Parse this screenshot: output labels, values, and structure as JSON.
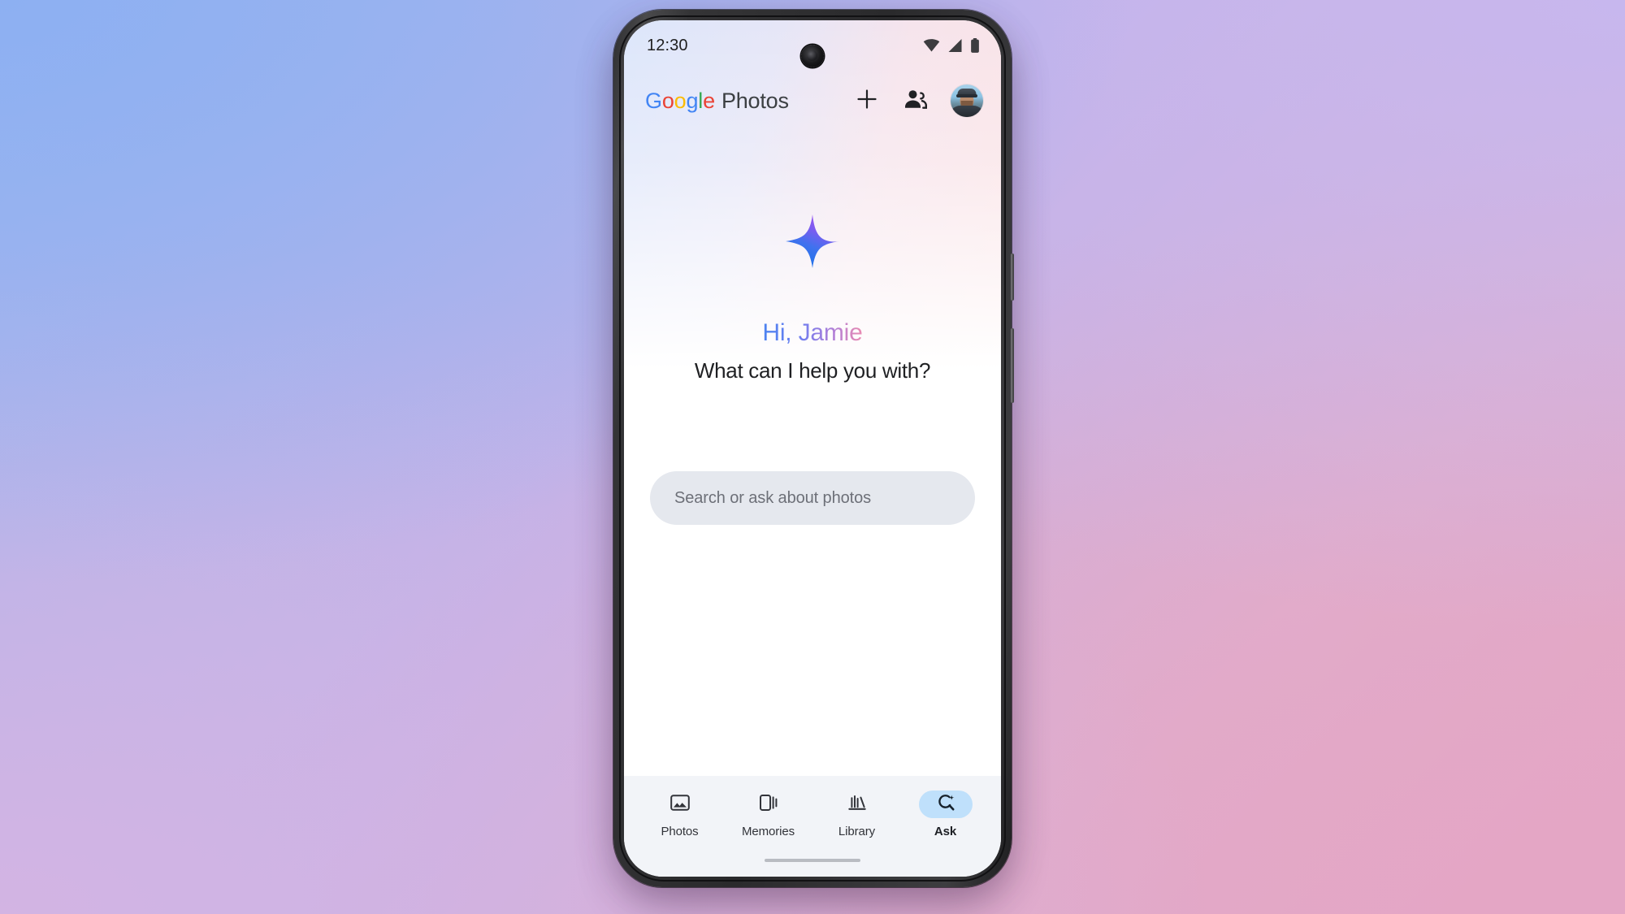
{
  "wallpaper": {
    "color_top_left": "#8db0f2",
    "color_top_right": "#c7b7ee",
    "color_bottom_left": "#d3b4e3",
    "color_bottom_right": "#e4a6c5"
  },
  "device": {
    "frame_color": "#2c2c2e",
    "screen_background": "#ffffff"
  },
  "status_bar": {
    "time": "12:30",
    "icons": [
      "wifi-icon",
      "cellular-signal-icon",
      "battery-icon"
    ]
  },
  "app_bar": {
    "brand_google": "Google",
    "brand_google_letters": [
      {
        "ch": "G",
        "color": "#4285F4"
      },
      {
        "ch": "o",
        "color": "#EA4335"
      },
      {
        "ch": "o",
        "color": "#FBBC05"
      },
      {
        "ch": "g",
        "color": "#4285F4"
      },
      {
        "ch": "l",
        "color": "#34A853"
      },
      {
        "ch": "e",
        "color": "#EA4335"
      }
    ],
    "brand_product": "Photos",
    "brand_product_color": "#3c4043",
    "actions": [
      {
        "name": "add-button",
        "icon": "plus-icon"
      },
      {
        "name": "sharing-button",
        "icon": "people-icon"
      },
      {
        "name": "account-avatar",
        "icon": "avatar"
      }
    ]
  },
  "hero": {
    "sparkle_icon": "gemini-sparkle-icon",
    "sparkle_gradient_from": "#8b5cf6",
    "sparkle_gradient_to": "#1a73e8",
    "greeting": "Hi, Jamie",
    "greeting_gradient_from": "#4a83f0",
    "greeting_gradient_to": "#ec8bb0",
    "subtitle": "What can I help you with?"
  },
  "search": {
    "placeholder": "Search or ask about photos",
    "value": "",
    "background": "#e5e8ee"
  },
  "bottom_nav": {
    "background": "#f2f4f8",
    "active_pill_color": "#bfe0fb",
    "items": [
      {
        "label": "Photos",
        "icon": "photo-image-icon",
        "active": false
      },
      {
        "label": "Memories",
        "icon": "memories-cards-icon",
        "active": false
      },
      {
        "label": "Library",
        "icon": "library-books-icon",
        "active": false
      },
      {
        "label": "Ask",
        "icon": "ask-search-sparkle-icon",
        "active": true
      }
    ]
  },
  "gesture_bar": {
    "present": true,
    "color": "#b9bcc2"
  }
}
